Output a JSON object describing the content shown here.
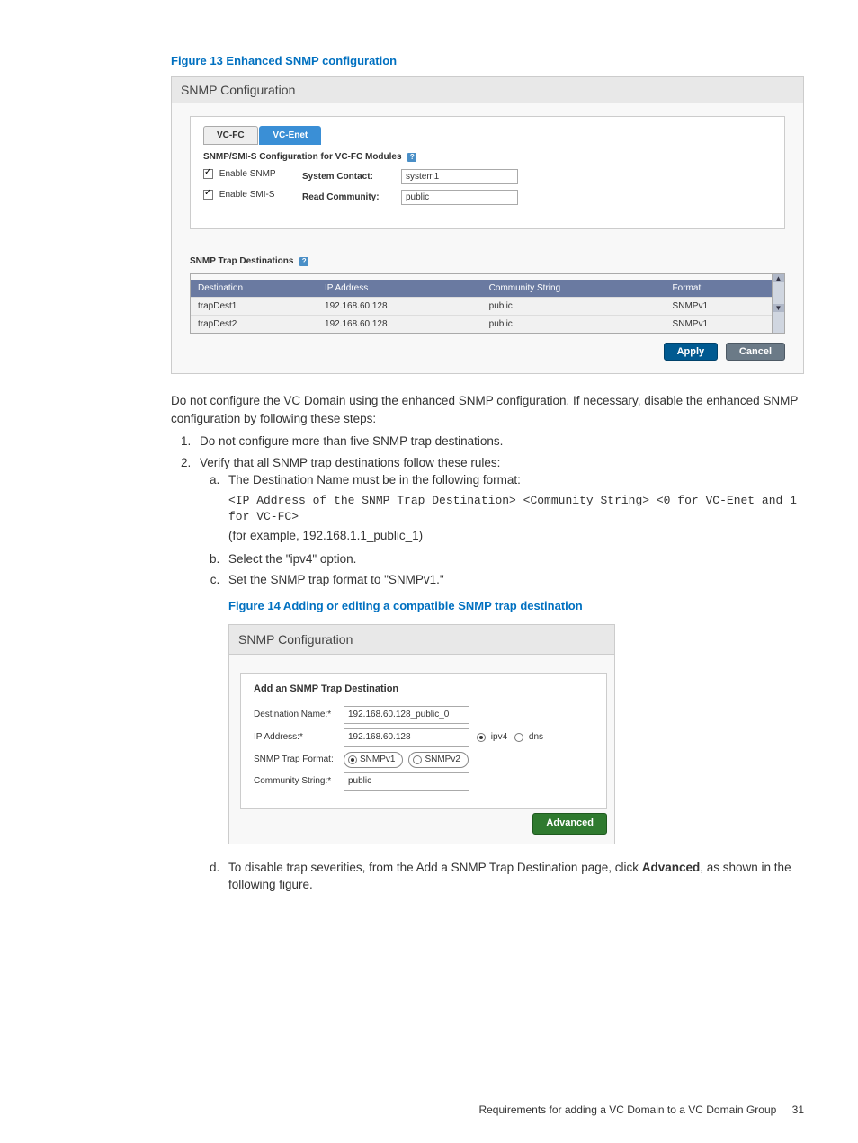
{
  "figure13": {
    "caption": "Figure 13 Enhanced SNMP configuration",
    "title": "SNMP Configuration",
    "tabs": {
      "vcfc": "VC-FC",
      "vcenet": "VC-Enet"
    },
    "section_title": "SNMP/SMI-S Configuration for VC-FC Modules",
    "help": "?",
    "enable_snmp": "Enable SNMP",
    "enable_smis": "Enable SMI-S",
    "system_contact_label": "System Contact:",
    "system_contact_value": "system1",
    "read_community_label": "Read Community:",
    "read_community_value": "public",
    "trap_section": "SNMP Trap Destinations",
    "headers": {
      "destination": "Destination",
      "ip": "IP Address",
      "community": "Community String",
      "format": "Format"
    },
    "rows": [
      {
        "destination": "trapDest1",
        "ip": "192.168.60.128",
        "community": "public",
        "format": "SNMPv1"
      },
      {
        "destination": "trapDest2",
        "ip": "192.168.60.128",
        "community": "public",
        "format": "SNMPv1"
      }
    ],
    "apply": "Apply",
    "cancel": "Cancel"
  },
  "body": {
    "intro": "Do not configure the VC Domain using the enhanced SNMP configuration. If necessary, disable the enhanced SNMP configuration by following these steps:",
    "step1": "Do not configure more than five SNMP trap destinations.",
    "step2": "Verify that all SNMP trap destinations follow these rules:",
    "step2a": "The Destination Name must be in the following format:",
    "code_line": "<IP Address of the SNMP Trap Destination>_<Community String>_<0 for VC-Enet and 1 for VC-FC>",
    "example": "(for example, 192.168.1.1_public_1)",
    "step2b": "Select the \"ipv4\" option.",
    "step2c": "Set the SNMP trap format to \"SNMPv1.\"",
    "step2d_pre": "To disable trap severities, from the Add a SNMP Trap Destination page, click ",
    "step2d_bold": "Advanced",
    "step2d_post": ", as shown in the following figure."
  },
  "figure14": {
    "caption": "Figure 14 Adding or editing a compatible SNMP trap destination",
    "title": "SNMP Configuration",
    "section": "Add an SNMP Trap Destination",
    "dest_name_label": "Destination Name:*",
    "dest_name_value": "192.168.60.128_public_0",
    "ip_label": "IP Address:*",
    "ip_value": "192.168.60.128",
    "ipv4": "ipv4",
    "dns": "dns",
    "format_label": "SNMP Trap Format:",
    "snmpv1": "SNMPv1",
    "snmpv2": "SNMPv2",
    "community_label": "Community String:*",
    "community_value": "public",
    "advanced": "Advanced"
  },
  "footer": {
    "text": "Requirements for adding a VC Domain to a VC Domain Group",
    "page": "31"
  }
}
